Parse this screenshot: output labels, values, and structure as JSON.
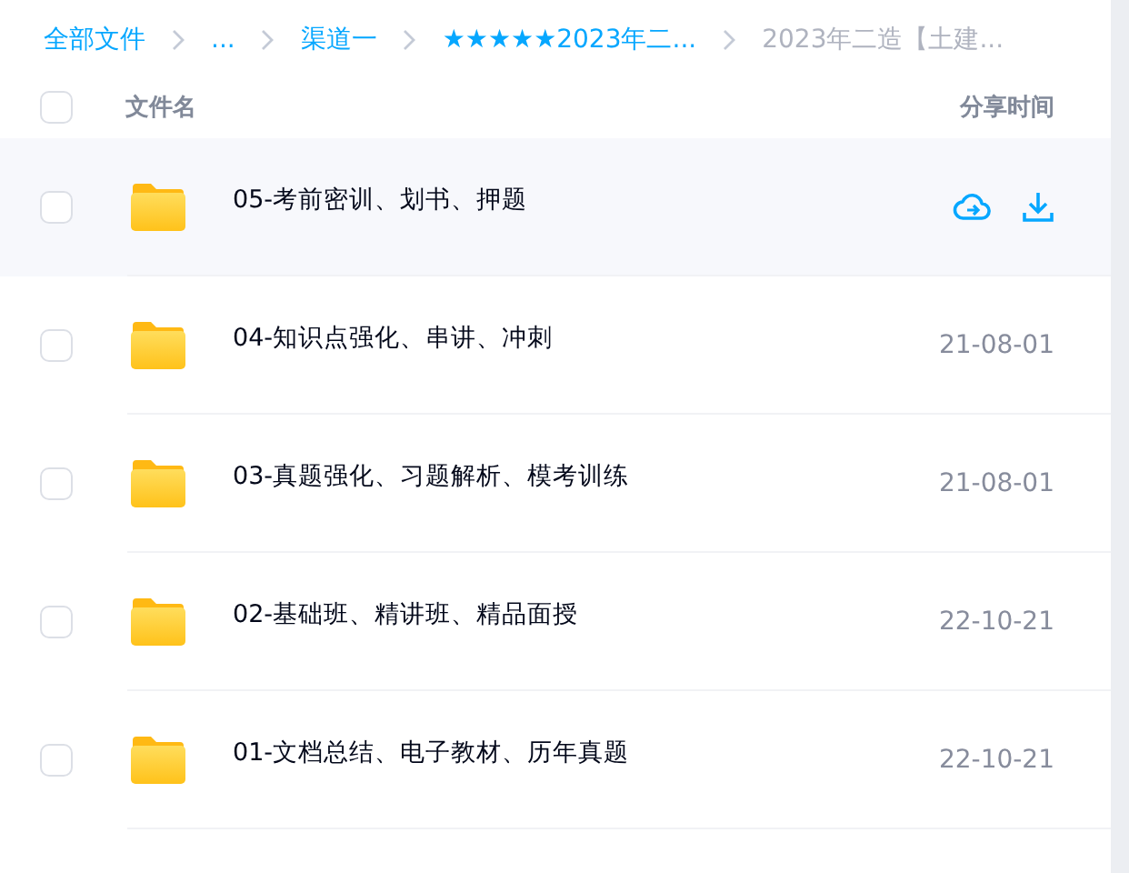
{
  "breadcrumb": [
    {
      "label": "全部文件",
      "current": false
    },
    {
      "label": "...",
      "current": false
    },
    {
      "label": "渠道一",
      "current": false
    },
    {
      "label": "★★★★★2023年二...",
      "current": false
    },
    {
      "label": "2023年二造【土建...",
      "current": true
    }
  ],
  "table": {
    "select_all": {
      "checked": false
    },
    "columns": [
      "文件名",
      "分享时间"
    ],
    "rows": [
      {
        "name": "05-考前密训、划书、押题",
        "hovered": true,
        "checked": false
      },
      {
        "name": "04-知识点强化、串讲、冲刺",
        "date": "21-08-01",
        "hovered": false,
        "checked": false
      },
      {
        "name": "03-真题强化、习题解析、模考训练",
        "date": "21-08-01",
        "hovered": false,
        "checked": false
      },
      {
        "name": "02-基础班、精讲班、精品面授",
        "date": "22-10-21",
        "hovered": false,
        "checked": false
      },
      {
        "name": "01-文档总结、电子教材、历年真题",
        "date": "22-10-21",
        "hovered": false,
        "checked": false
      }
    ]
  }
}
